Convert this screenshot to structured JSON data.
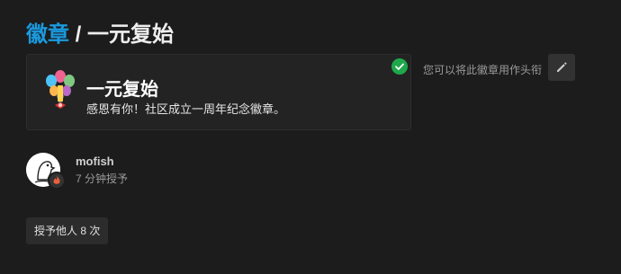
{
  "breadcrumb": {
    "parent": "徽章",
    "separator": " / ",
    "current": "一元复始"
  },
  "badge": {
    "name": "一元复始",
    "description": "感恩有你！社区成立一周年纪念徽章。",
    "icon": "balloon-bouquet-icon"
  },
  "actions": {
    "avatar_hint": "您可以将此徽章用作头衔",
    "edit_icon": "pencil-icon",
    "granted_icon": "check-circle-icon"
  },
  "grant": {
    "username": "mofish",
    "time": "7 分钟授予"
  },
  "others_button": "授予他人 8 次",
  "colors": {
    "link": "#1a9ae0",
    "check": "#1ea84b",
    "background": "#1c1c1c"
  }
}
